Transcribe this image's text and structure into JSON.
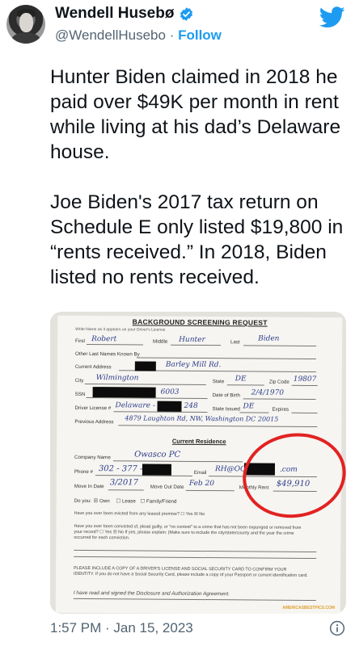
{
  "tweet": {
    "author_name": "Wendell Husebø",
    "handle": "@WendellHusebo",
    "separator": " · ",
    "follow_label": "Follow",
    "paragraph_1": "Hunter Biden claimed in 2018 he paid over $49K per month in rent while living at his dad’s Delaware house.",
    "paragraph_2": "Joe Biden's 2017 tax return on Schedule E only listed $19,800 in “rents received.” In 2018, Biden listed no rents received.",
    "timestamp": "1:57 PM · Jan 15, 2023"
  },
  "icons": {
    "verified": "verified-badge-icon",
    "brand": "twitter-bird-icon",
    "info": "info-icon"
  },
  "colors": {
    "accent": "#1d9bf0",
    "text": "#0f1419",
    "muted": "#536471",
    "highlight_circle": "#e22222"
  },
  "document": {
    "title": "BACKGROUND SCREENING REQUEST",
    "instruction": "Write Name as it appears on your Driver's License",
    "labels": {
      "first": "First",
      "middle": "Middle",
      "last": "Last",
      "other_names": "Other Last Names Known By",
      "current_address": "Current Address",
      "city": "City",
      "state": "State",
      "zip": "Zip Code",
      "ssn": "SSN",
      "dob": "Date of Birth",
      "license": "Driver License #",
      "state_issued": "State Issued",
      "expires": "Expires",
      "previous_address": "Previous Address",
      "company_name": "Company Name",
      "phone": "Phone #",
      "email": "Email",
      "move_in": "Move In Date",
      "move_out": "Move Out Date",
      "monthly_rent": "Monthly Rent",
      "do_you": "Do you:",
      "own": "Own",
      "lease": "Lease",
      "family": "Family/Friend"
    },
    "handwritten": {
      "first": "Robert",
      "middle": "Hunter",
      "last": "Biden",
      "address": "Barley Mill Rd.",
      "city": "Wilmington",
      "state": "DE",
      "zip": "19807",
      "ssn_tail": "6003",
      "dob": "2/4/1970",
      "license_prefix": "Delaware -",
      "license_tail": "248",
      "state_issued": "DE",
      "previous_address": "4879 Laughton Rd, NW, Washington DC 20015",
      "company": "Owasco PC",
      "phone": "302 - 377 -",
      "email_prefix": "RH@OC",
      "email_suffix": ".com",
      "move_in": "3/2017",
      "move_out": "Feb 20",
      "rent": "$49,910"
    },
    "section_residence": "Current Residence",
    "q_evicted": "Have you ever been evicted from any leased premise? ☐ Yes ☒ No",
    "q_convicted": "Have you ever been convicted of, plead guilty, or \"no contest\" to a crime that has not been expunged or removed from your record? ☐ Yes ☒ No If yes, please explain: (Make sure to include the city/state/county and the year the crime occurred for each conviction.",
    "notice": "PLEASE INCLUDE A COPY OF A DRIVER'S LICENSE AND SOCIAL SECURITY CARD TO CONFIRM YOUR IDENTITY. If you do not have a Social Security Card, please include a copy of your Passport or current identification card.",
    "signature_line": "I have read and signed the Disclosure and Authorization Agreement.",
    "watermark": "AMERICASBESTPICS.COM"
  }
}
